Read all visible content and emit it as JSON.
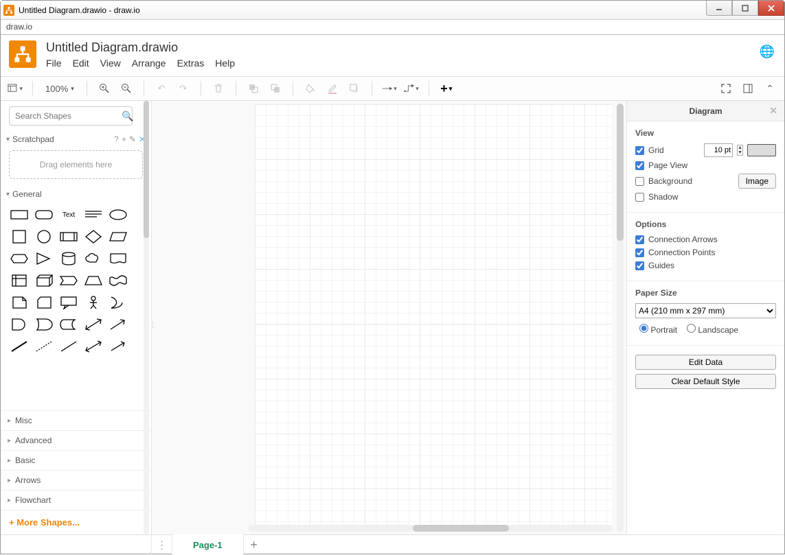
{
  "window": {
    "title": "Untitled Diagram.drawio - draw.io",
    "secondtab": "draw.io"
  },
  "header": {
    "doc_title": "Untitled Diagram.drawio",
    "menu": {
      "file": "File",
      "edit": "Edit",
      "view": "View",
      "arrange": "Arrange",
      "extras": "Extras",
      "help": "Help"
    }
  },
  "toolbar": {
    "zoom": "100%"
  },
  "sidebar": {
    "search_placeholder": "Search Shapes",
    "scratchpad_title": "Scratchpad",
    "scratchpad_hint": "Drag elements here",
    "general_title": "General",
    "text_label": "Text",
    "cats": {
      "misc": "Misc",
      "advanced": "Advanced",
      "basic": "Basic",
      "arrows": "Arrows",
      "flowchart": "Flowchart"
    },
    "more_shapes": "+ More Shapes..."
  },
  "footer": {
    "page_tab": "Page-1"
  },
  "right": {
    "title": "Diagram",
    "view_h": "View",
    "grid": "Grid",
    "grid_size": "10 pt",
    "pageview": "Page View",
    "background": "Background",
    "image_btn": "Image",
    "shadow": "Shadow",
    "options_h": "Options",
    "conn_arrows": "Connection Arrows",
    "conn_points": "Connection Points",
    "guides": "Guides",
    "paper_h": "Paper Size",
    "paper_value": "A4 (210 mm x 297 mm)",
    "portrait": "Portrait",
    "landscape": "Landscape",
    "edit_data": "Edit Data",
    "clear_style": "Clear Default Style"
  }
}
